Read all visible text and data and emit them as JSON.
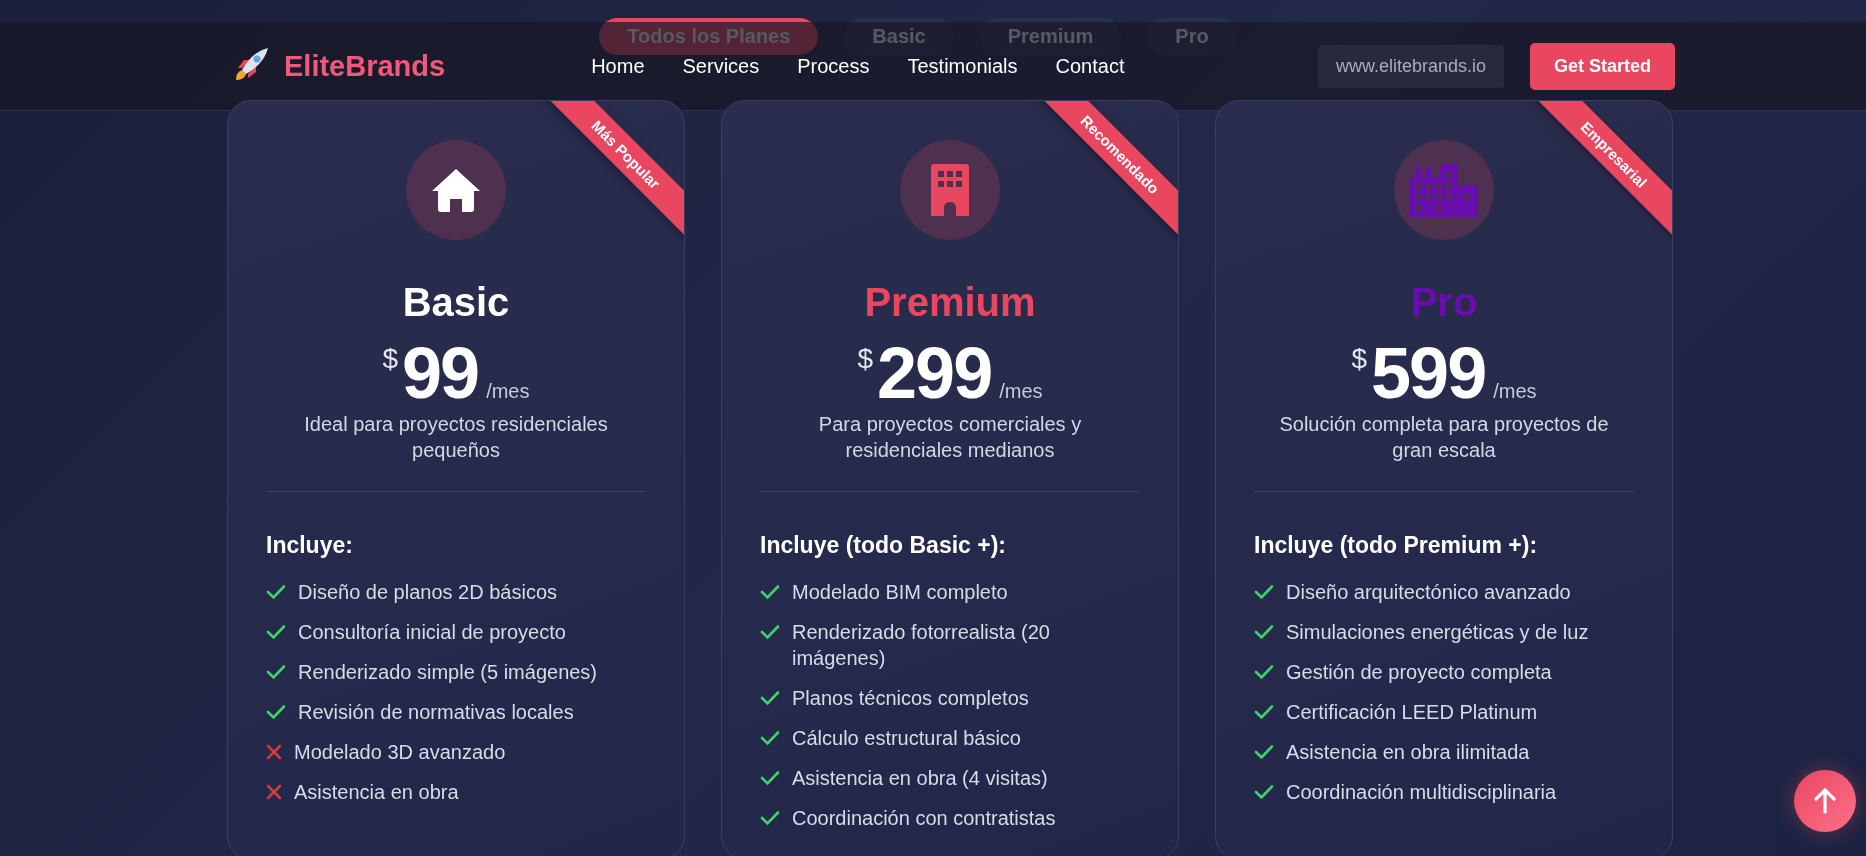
{
  "filter_tabs": [
    {
      "label": "Todos los Planes",
      "selected": true
    },
    {
      "label": "Basic",
      "selected": false
    },
    {
      "label": "Premium",
      "selected": false
    },
    {
      "label": "Pro",
      "selected": false
    }
  ],
  "header": {
    "brand": "EliteBrands",
    "nav": [
      "Home",
      "Services",
      "Process",
      "Testimonials",
      "Contact"
    ],
    "url": "www.elitebrands.io",
    "cta": "Get Started"
  },
  "plans": [
    {
      "badge": "Más Popular",
      "kind": "house",
      "name": "Basic",
      "color": "#ffffff",
      "currency": "$",
      "price": "99",
      "period": "/mes",
      "description": "Ideal para proyectos residenciales pequeños",
      "includes": "Incluye:",
      "features": [
        {
          "text": "Diseño de planos 2D básicos",
          "included": true
        },
        {
          "text": "Consultoría inicial de proyecto",
          "included": true
        },
        {
          "text": "Renderizado simple (5 imágenes)",
          "included": true
        },
        {
          "text": "Revisión de normativas locales",
          "included": true
        },
        {
          "text": "Modelado 3D avanzado",
          "included": false
        },
        {
          "text": "Asistencia en obra",
          "included": false
        }
      ]
    },
    {
      "badge": "Recomendado",
      "kind": "building",
      "name": "Premium",
      "color": "#e8475f",
      "currency": "$",
      "price": "299",
      "period": "/mes",
      "description": "Para proyectos comerciales y residenciales medianos",
      "includes": "Incluye (todo Basic +):",
      "features": [
        {
          "text": "Modelado BIM completo",
          "included": true
        },
        {
          "text": "Renderizado fotorrealista (20 imágenes)",
          "included": true
        },
        {
          "text": "Planos técnicos completos",
          "included": true
        },
        {
          "text": "Cálculo estructural básico",
          "included": true
        },
        {
          "text": "Asistencia en obra (4 visitas)",
          "included": true
        },
        {
          "text": "Coordinación con contratistas",
          "included": true
        }
      ]
    },
    {
      "badge": "Empresarial",
      "kind": "city",
      "name": "Pro",
      "color": "#6a0dad",
      "currency": "$",
      "price": "599",
      "period": "/mes",
      "description": "Solución completa para proyectos de gran escala",
      "includes": "Incluye (todo Premium +):",
      "features": [
        {
          "text": "Diseño arquitectónico avanzado",
          "included": true
        },
        {
          "text": "Simulaciones energéticas y de luz",
          "included": true
        },
        {
          "text": "Gestión de proyecto completa",
          "included": true
        },
        {
          "text": "Certificación LEED Platinum",
          "included": true
        },
        {
          "text": "Asistencia en obra ilimitada",
          "included": true
        },
        {
          "text": "Coordinación multidisciplinaria",
          "included": true
        }
      ]
    }
  ]
}
